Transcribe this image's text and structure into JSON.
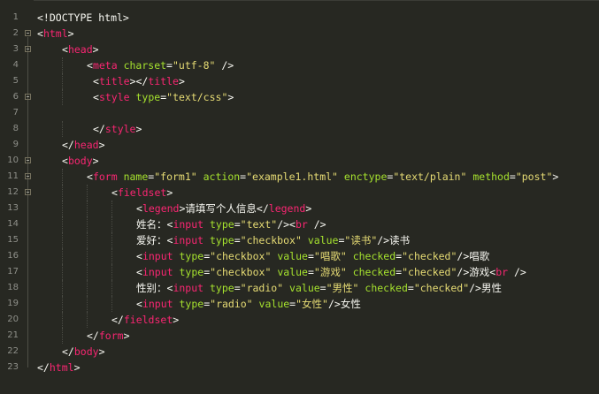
{
  "editor": {
    "theme_colors": {
      "background": "#272822",
      "tag": "#f92672",
      "attribute": "#a6e22e",
      "string": "#e6db74",
      "text": "#f8f8f2",
      "line_number": "#8f908a"
    },
    "lines": [
      {
        "number": "1",
        "fold": false,
        "indent": 0,
        "tokens": [
          {
            "t": "punct",
            "v": "<!DOCTYPE html>"
          }
        ]
      },
      {
        "number": "2",
        "fold": true,
        "indent": 0,
        "tokens": [
          {
            "t": "punct",
            "v": "<"
          },
          {
            "t": "tag",
            "v": "html"
          },
          {
            "t": "punct",
            "v": ">"
          }
        ]
      },
      {
        "number": "3",
        "fold": true,
        "indent": 1,
        "tokens": [
          {
            "t": "punct",
            "v": "<"
          },
          {
            "t": "tag",
            "v": "head"
          },
          {
            "t": "punct",
            "v": ">"
          }
        ]
      },
      {
        "number": "4",
        "fold": false,
        "indent": 2,
        "tokens": [
          {
            "t": "punct",
            "v": "<"
          },
          {
            "t": "tag",
            "v": "meta"
          },
          {
            "t": "punct",
            "v": " "
          },
          {
            "t": "attr",
            "v": "charset"
          },
          {
            "t": "punct",
            "v": "="
          },
          {
            "t": "str",
            "v": "\"utf-8\""
          },
          {
            "t": "punct",
            "v": " />"
          }
        ]
      },
      {
        "number": "5",
        "fold": false,
        "indent": 2,
        "offset": 1,
        "tokens": [
          {
            "t": "punct",
            "v": "<"
          },
          {
            "t": "tag",
            "v": "title"
          },
          {
            "t": "punct",
            "v": "></"
          },
          {
            "t": "tag",
            "v": "title"
          },
          {
            "t": "punct",
            "v": ">"
          }
        ]
      },
      {
        "number": "6",
        "fold": true,
        "indent": 2,
        "offset": 1,
        "tokens": [
          {
            "t": "punct",
            "v": "<"
          },
          {
            "t": "tag",
            "v": "style"
          },
          {
            "t": "punct",
            "v": " "
          },
          {
            "t": "attr",
            "v": "type"
          },
          {
            "t": "punct",
            "v": "="
          },
          {
            "t": "str",
            "v": "\"text/css\""
          },
          {
            "t": "punct",
            "v": ">"
          }
        ]
      },
      {
        "number": "7",
        "fold": false,
        "indent": 0,
        "tokens": []
      },
      {
        "number": "8",
        "fold": false,
        "indent": 2,
        "offset": 1,
        "tokens": [
          {
            "t": "punct",
            "v": "</"
          },
          {
            "t": "tag",
            "v": "style"
          },
          {
            "t": "punct",
            "v": ">"
          }
        ]
      },
      {
        "number": "9",
        "fold": false,
        "indent": 1,
        "tokens": [
          {
            "t": "punct",
            "v": "</"
          },
          {
            "t": "tag",
            "v": "head"
          },
          {
            "t": "punct",
            "v": ">"
          }
        ]
      },
      {
        "number": "10",
        "fold": true,
        "indent": 1,
        "tokens": [
          {
            "t": "punct",
            "v": "<"
          },
          {
            "t": "tag",
            "v": "body"
          },
          {
            "t": "punct",
            "v": ">"
          }
        ]
      },
      {
        "number": "11",
        "fold": true,
        "indent": 2,
        "tokens": [
          {
            "t": "punct",
            "v": "<"
          },
          {
            "t": "tag",
            "v": "form"
          },
          {
            "t": "punct",
            "v": " "
          },
          {
            "t": "attr",
            "v": "name"
          },
          {
            "t": "punct",
            "v": "="
          },
          {
            "t": "str",
            "v": "\"form1\""
          },
          {
            "t": "punct",
            "v": " "
          },
          {
            "t": "attr",
            "v": "action"
          },
          {
            "t": "punct",
            "v": "="
          },
          {
            "t": "str",
            "v": "\"example1.html\""
          },
          {
            "t": "punct",
            "v": " "
          },
          {
            "t": "attr",
            "v": "enctype"
          },
          {
            "t": "punct",
            "v": "="
          },
          {
            "t": "str",
            "v": "\"text/plain\""
          },
          {
            "t": "punct",
            "v": " "
          },
          {
            "t": "attr",
            "v": "method"
          },
          {
            "t": "punct",
            "v": "="
          },
          {
            "t": "str",
            "v": "\"post\""
          },
          {
            "t": "punct",
            "v": ">"
          }
        ]
      },
      {
        "number": "12",
        "fold": true,
        "indent": 3,
        "tokens": [
          {
            "t": "punct",
            "v": "<"
          },
          {
            "t": "tag",
            "v": "fieldset"
          },
          {
            "t": "punct",
            "v": ">"
          }
        ]
      },
      {
        "number": "13",
        "fold": false,
        "indent": 4,
        "tokens": [
          {
            "t": "punct",
            "v": "<"
          },
          {
            "t": "tag",
            "v": "legend"
          },
          {
            "t": "punct",
            "v": ">"
          },
          {
            "t": "text",
            "v": "请填写个人信息"
          },
          {
            "t": "punct",
            "v": "</"
          },
          {
            "t": "tag",
            "v": "legend"
          },
          {
            "t": "punct",
            "v": ">"
          }
        ]
      },
      {
        "number": "14",
        "fold": false,
        "indent": 4,
        "tokens": [
          {
            "t": "text",
            "v": "姓名："
          },
          {
            "t": "punct",
            "v": "<"
          },
          {
            "t": "tag",
            "v": "input"
          },
          {
            "t": "punct",
            "v": " "
          },
          {
            "t": "attr",
            "v": "type"
          },
          {
            "t": "punct",
            "v": "="
          },
          {
            "t": "str",
            "v": "\"text\""
          },
          {
            "t": "punct",
            "v": "/><"
          },
          {
            "t": "tag",
            "v": "br"
          },
          {
            "t": "punct",
            "v": " />"
          }
        ]
      },
      {
        "number": "15",
        "fold": false,
        "indent": 4,
        "tokens": [
          {
            "t": "text",
            "v": "爱好："
          },
          {
            "t": "punct",
            "v": "<"
          },
          {
            "t": "tag",
            "v": "input"
          },
          {
            "t": "punct",
            "v": " "
          },
          {
            "t": "attr",
            "v": "type"
          },
          {
            "t": "punct",
            "v": "="
          },
          {
            "t": "str",
            "v": "\"checkbox\""
          },
          {
            "t": "punct",
            "v": " "
          },
          {
            "t": "attr",
            "v": "value"
          },
          {
            "t": "punct",
            "v": "="
          },
          {
            "t": "str",
            "v": "\"读书\""
          },
          {
            "t": "punct",
            "v": "/>"
          },
          {
            "t": "text",
            "v": "读书"
          }
        ]
      },
      {
        "number": "16",
        "fold": false,
        "indent": 4,
        "tokens": [
          {
            "t": "punct",
            "v": "<"
          },
          {
            "t": "tag",
            "v": "input"
          },
          {
            "t": "punct",
            "v": " "
          },
          {
            "t": "attr",
            "v": "type"
          },
          {
            "t": "punct",
            "v": "="
          },
          {
            "t": "str",
            "v": "\"checkbox\""
          },
          {
            "t": "punct",
            "v": " "
          },
          {
            "t": "attr",
            "v": "value"
          },
          {
            "t": "punct",
            "v": "="
          },
          {
            "t": "str",
            "v": "\"唱歌\""
          },
          {
            "t": "punct",
            "v": " "
          },
          {
            "t": "attr",
            "v": "checked"
          },
          {
            "t": "punct",
            "v": "="
          },
          {
            "t": "str",
            "v": "\"checked\""
          },
          {
            "t": "punct",
            "v": "/>"
          },
          {
            "t": "text",
            "v": "唱歌"
          }
        ]
      },
      {
        "number": "17",
        "fold": false,
        "indent": 4,
        "tokens": [
          {
            "t": "punct",
            "v": "<"
          },
          {
            "t": "tag",
            "v": "input"
          },
          {
            "t": "punct",
            "v": " "
          },
          {
            "t": "attr",
            "v": "type"
          },
          {
            "t": "punct",
            "v": "="
          },
          {
            "t": "str",
            "v": "\"checkbox\""
          },
          {
            "t": "punct",
            "v": " "
          },
          {
            "t": "attr",
            "v": "value"
          },
          {
            "t": "punct",
            "v": "="
          },
          {
            "t": "str",
            "v": "\"游戏\""
          },
          {
            "t": "punct",
            "v": " "
          },
          {
            "t": "attr",
            "v": "checked"
          },
          {
            "t": "punct",
            "v": "="
          },
          {
            "t": "str",
            "v": "\"checked\""
          },
          {
            "t": "punct",
            "v": "/>"
          },
          {
            "t": "text",
            "v": "游戏"
          },
          {
            "t": "punct",
            "v": "<"
          },
          {
            "t": "tag",
            "v": "br"
          },
          {
            "t": "punct",
            "v": " />"
          }
        ]
      },
      {
        "number": "18",
        "fold": false,
        "indent": 4,
        "tokens": [
          {
            "t": "text",
            "v": "性别："
          },
          {
            "t": "punct",
            "v": "<"
          },
          {
            "t": "tag",
            "v": "input"
          },
          {
            "t": "punct",
            "v": " "
          },
          {
            "t": "attr",
            "v": "type"
          },
          {
            "t": "punct",
            "v": "="
          },
          {
            "t": "str",
            "v": "\"radio\""
          },
          {
            "t": "punct",
            "v": " "
          },
          {
            "t": "attr",
            "v": "value"
          },
          {
            "t": "punct",
            "v": "="
          },
          {
            "t": "str",
            "v": "\"男性\""
          },
          {
            "t": "punct",
            "v": " "
          },
          {
            "t": "attr",
            "v": "checked"
          },
          {
            "t": "punct",
            "v": "="
          },
          {
            "t": "str",
            "v": "\"checked\""
          },
          {
            "t": "punct",
            "v": "/>"
          },
          {
            "t": "text",
            "v": "男性"
          }
        ]
      },
      {
        "number": "19",
        "fold": false,
        "indent": 4,
        "tokens": [
          {
            "t": "punct",
            "v": "<"
          },
          {
            "t": "tag",
            "v": "input"
          },
          {
            "t": "punct",
            "v": " "
          },
          {
            "t": "attr",
            "v": "type"
          },
          {
            "t": "punct",
            "v": "="
          },
          {
            "t": "str",
            "v": "\"radio\""
          },
          {
            "t": "punct",
            "v": " "
          },
          {
            "t": "attr",
            "v": "value"
          },
          {
            "t": "punct",
            "v": "="
          },
          {
            "t": "str",
            "v": "\"女性\""
          },
          {
            "t": "punct",
            "v": "/>"
          },
          {
            "t": "text",
            "v": "女性"
          }
        ]
      },
      {
        "number": "20",
        "fold": false,
        "indent": 3,
        "tokens": [
          {
            "t": "punct",
            "v": "</"
          },
          {
            "t": "tag",
            "v": "fieldset"
          },
          {
            "t": "punct",
            "v": ">"
          }
        ]
      },
      {
        "number": "21",
        "fold": false,
        "indent": 2,
        "tokens": [
          {
            "t": "punct",
            "v": "</"
          },
          {
            "t": "tag",
            "v": "form"
          },
          {
            "t": "punct",
            "v": ">"
          }
        ]
      },
      {
        "number": "22",
        "fold": false,
        "indent": 1,
        "tokens": [
          {
            "t": "punct",
            "v": "</"
          },
          {
            "t": "tag",
            "v": "body"
          },
          {
            "t": "punct",
            "v": ">"
          }
        ]
      },
      {
        "number": "23",
        "fold": false,
        "indent": 0,
        "tokens": [
          {
            "t": "punct",
            "v": "</"
          },
          {
            "t": "tag",
            "v": "html"
          },
          {
            "t": "punct",
            "v": ">"
          }
        ]
      }
    ]
  }
}
